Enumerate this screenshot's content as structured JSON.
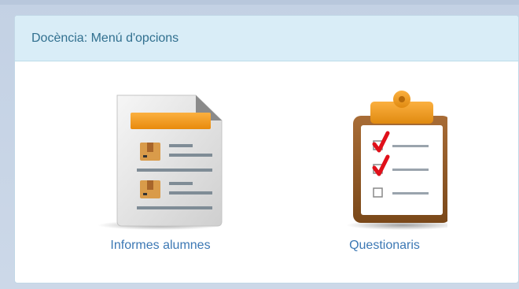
{
  "panel": {
    "title": "Docència: Menú d'opcions"
  },
  "options": [
    {
      "label": "Informes alumnes",
      "icon": "report-document-icon"
    },
    {
      "label": "Questionaris",
      "icon": "clipboard-checklist-icon"
    }
  ],
  "colors": {
    "header_bg": "#d9edf7",
    "header_text": "#31708f",
    "link_text": "#3c78b4",
    "accent_orange": "#f39c12",
    "check_red": "#e0101a"
  }
}
